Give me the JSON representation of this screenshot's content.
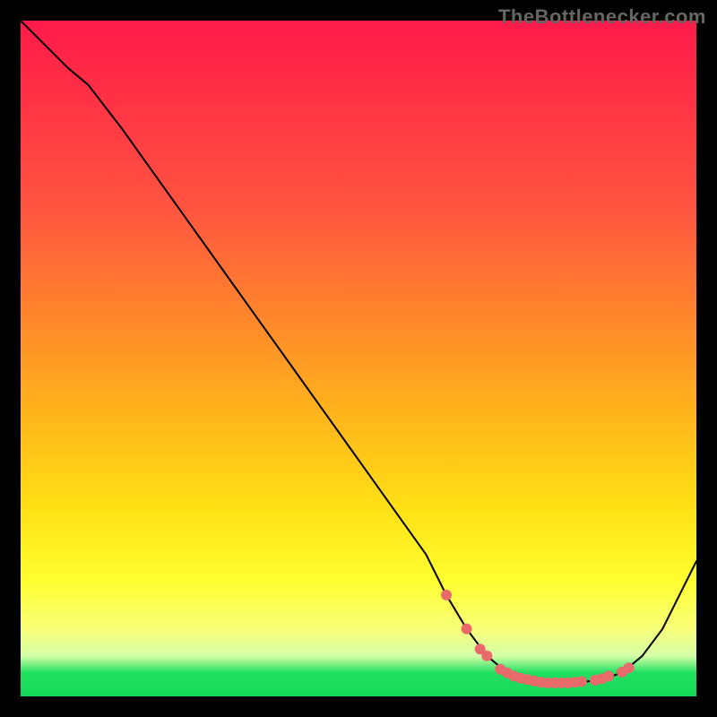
{
  "watermark": "TheBottlenecker.com",
  "colors": {
    "curve": "#000000",
    "marker": "#e86a6a",
    "frame": "#000000"
  },
  "chart_data": {
    "type": "line",
    "title": "",
    "xlabel": "",
    "ylabel": "",
    "xlim": [
      0,
      100
    ],
    "ylim": [
      0,
      100
    ],
    "grid": false,
    "legend": false,
    "series": [
      {
        "name": "bottleneck-curve",
        "x": [
          0,
          7,
          10,
          15,
          20,
          25,
          30,
          35,
          40,
          45,
          50,
          55,
          60,
          63,
          66,
          69,
          72,
          75,
          78,
          80,
          83,
          86,
          89,
          92,
          95,
          100
        ],
        "values": [
          100,
          93,
          90.5,
          84,
          77,
          70,
          63,
          56,
          49,
          42,
          35,
          28,
          21,
          15,
          10,
          6,
          3.5,
          2.3,
          2.0,
          2.0,
          2.1,
          2.5,
          3.5,
          6,
          10,
          20
        ]
      }
    ],
    "markers": {
      "name": "highlight-points",
      "x": [
        63,
        66,
        68,
        69,
        71,
        72,
        73,
        74,
        75,
        76,
        77,
        78,
        79,
        80,
        81,
        82,
        83,
        85,
        86,
        87,
        89,
        90
      ],
      "values": [
        15,
        10,
        7,
        6,
        4,
        3.5,
        3,
        2.7,
        2.5,
        2.3,
        2.1,
        2.0,
        2.0,
        2.0,
        2.0,
        2.1,
        2.2,
        2.4,
        2.6,
        3.0,
        3.6,
        4.2
      ]
    }
  }
}
